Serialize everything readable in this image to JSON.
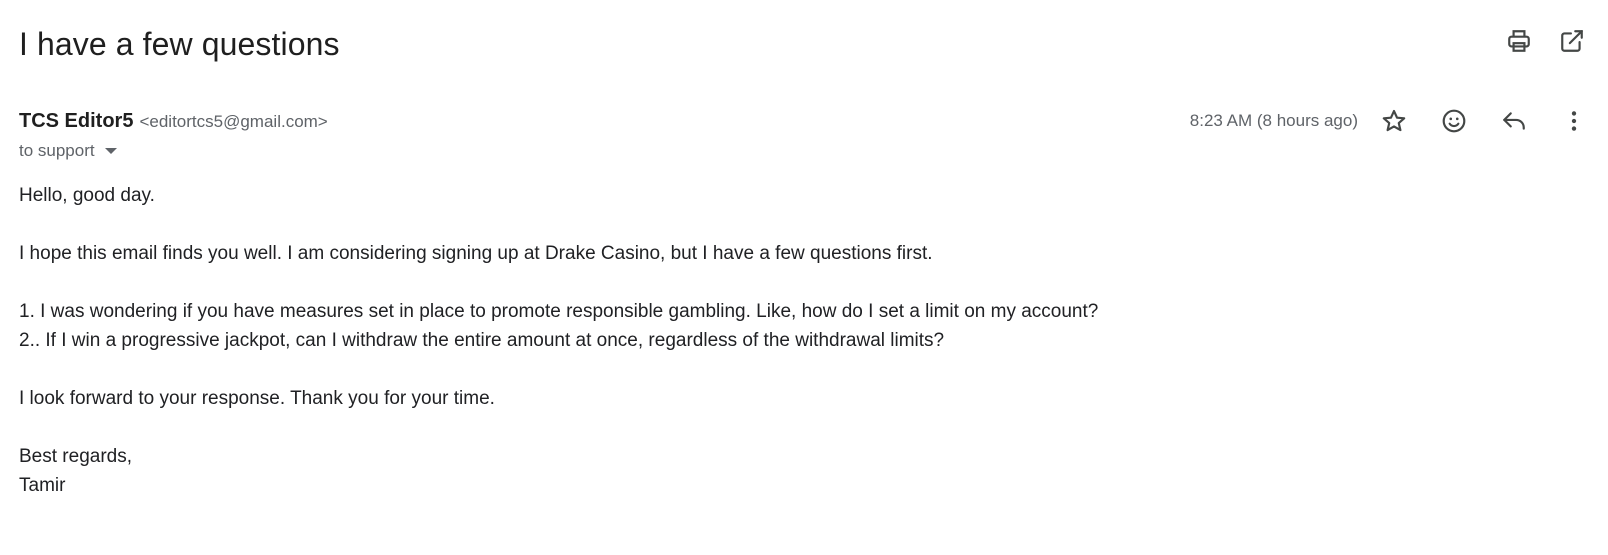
{
  "email": {
    "subject": "I have a few questions",
    "sender_name": "TCS Editor5",
    "sender_email": "<editortcs5@gmail.com>",
    "recipient": "to support",
    "timestamp": "8:23 AM (8 hours ago)",
    "body_lines": [
      "Hello, good day.",
      "",
      "I hope this email finds you well. I am considering signing up at Drake Casino, but I have a few questions first.",
      "",
      "1. I was wondering if you have measures set in place to promote responsible gambling. Like, how do I set a limit on my account?",
      "2.. If I win a progressive jackpot, can I withdraw the entire amount at once, regardless of the withdrawal limits?",
      "",
      "I look forward to your response. Thank you for your time.",
      "",
      "Best regards,",
      "Tamir"
    ]
  },
  "icons": {
    "print": "print-icon",
    "open_new_window": "open-in-new-window-icon",
    "recipient_caret": "caret-down-icon",
    "star": "star-icon",
    "emoji": "emoji-reaction-icon",
    "reply": "reply-icon",
    "more": "more-vert-icon"
  },
  "colors": {
    "text_primary": "#202124",
    "text_secondary": "#5f6368",
    "icon": "#444746",
    "background": "#ffffff"
  }
}
